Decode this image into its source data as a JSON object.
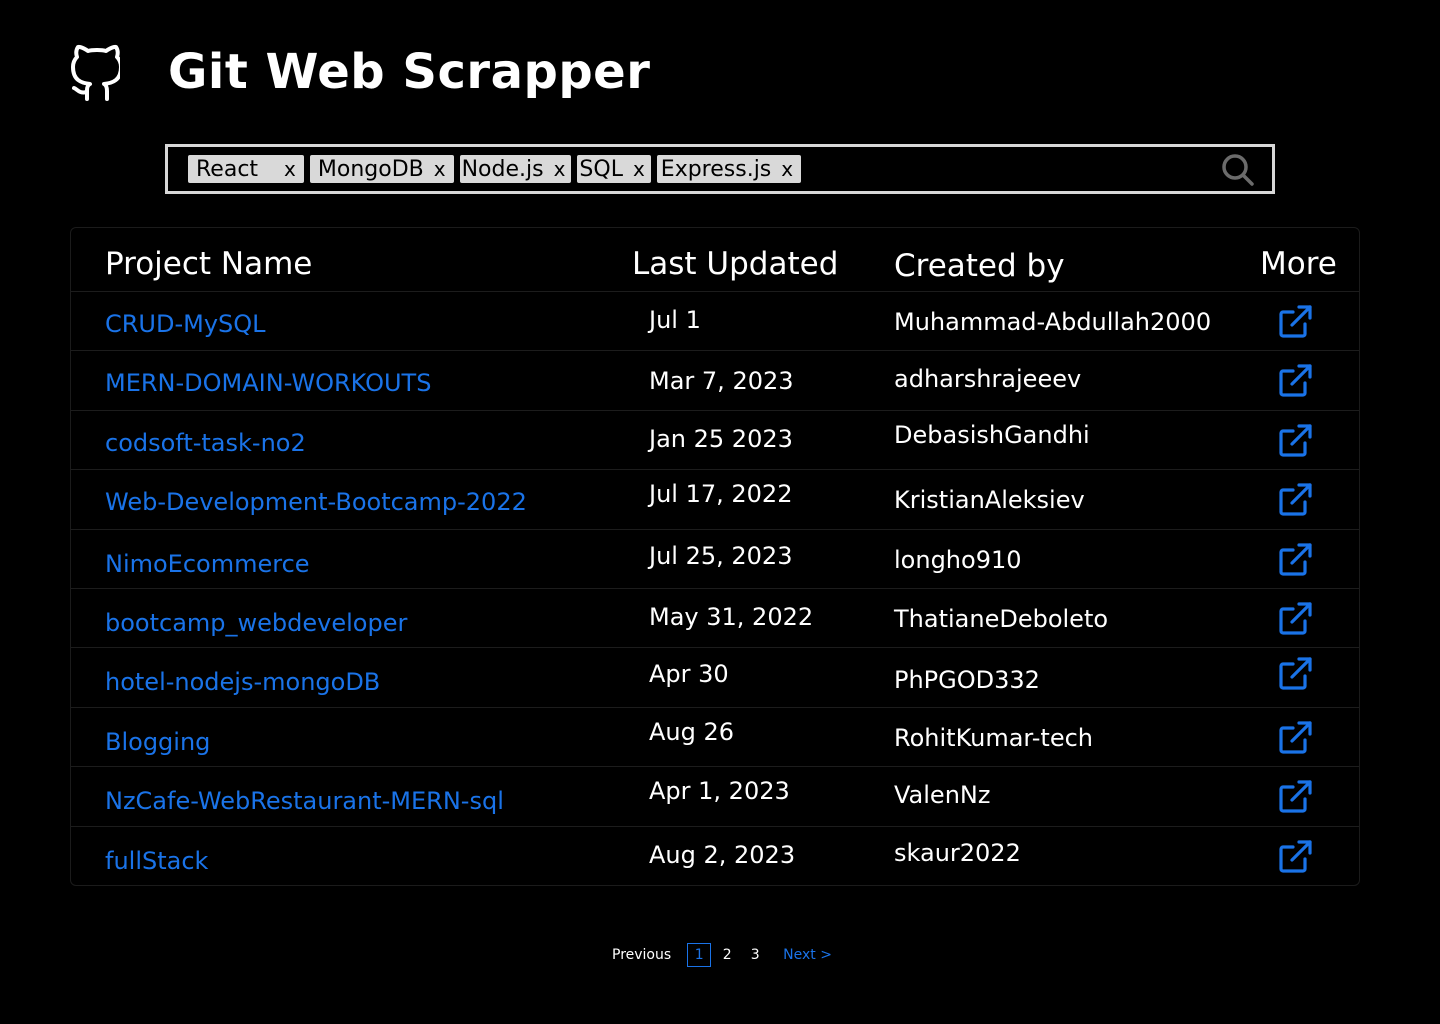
{
  "app": {
    "title": "Git Web Scrapper"
  },
  "search": {
    "tags": [
      {
        "label": "React",
        "remove": "x"
      },
      {
        "label": "MongoDB",
        "remove": "x"
      },
      {
        "label": "Node.js",
        "remove": "x"
      },
      {
        "label": "SQL",
        "remove": "x"
      },
      {
        "label": "Express.js",
        "remove": "x"
      }
    ],
    "icon": "search-icon"
  },
  "table": {
    "headers": {
      "project": "Project Name",
      "updated": "Last Updated",
      "created_by": "Created by",
      "more": "More"
    },
    "rows": [
      {
        "name": "CRUD-MySQL",
        "updated": "Jul 1",
        "created_by": "Muhammad-Abdullah2000"
      },
      {
        "name": "MERN-DOMAIN-WORKOUTS",
        "updated": "Mar 7, 2023",
        "created_by": "adharshrajeeev"
      },
      {
        "name": "codsoft-task-no2",
        "updated": "Jan 25 2023",
        "created_by": "DebasishGandhi"
      },
      {
        "name": "Web-Development-Bootcamp-2022",
        "updated": "Jul 17, 2022",
        "created_by": "KristianAleksiev"
      },
      {
        "name": "NimoEcommerce",
        "updated": "Jul 25, 2023",
        "created_by": "longho910"
      },
      {
        "name": "bootcamp_webdeveloper",
        "updated": "May 31, 2022",
        "created_by": "ThatianeDeboleto"
      },
      {
        "name": "hotel-nodejs-mongoDB",
        "updated": "Apr 30",
        "created_by": "PhPGOD332"
      },
      {
        "name": "Blogging",
        "updated": "Aug 26",
        "created_by": "RohitKumar-tech"
      },
      {
        "name": "NzCafe-WebRestaurant-MERN-sql",
        "updated": "Apr 1, 2023",
        "created_by": "ValenNz"
      },
      {
        "name": "fullStack",
        "updated": "Aug 2, 2023",
        "created_by": "skaur2022"
      }
    ],
    "more_icon": "external-link-icon"
  },
  "pagination": {
    "previous": "Previous",
    "pages": [
      "1",
      "2",
      "3"
    ],
    "current": "1",
    "next": "Next >"
  },
  "colors": {
    "background": "#000000",
    "link": "#1a73e8",
    "text": "#ffffff",
    "tag_bg": "#d9d9d9"
  }
}
